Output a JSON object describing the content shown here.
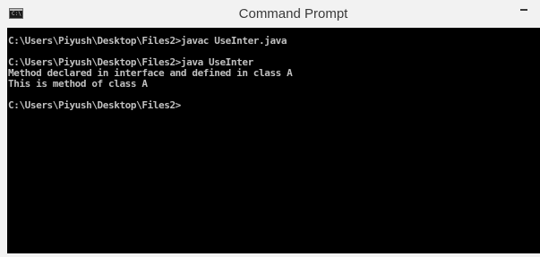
{
  "window": {
    "title": "Command Prompt",
    "app_icon": "console-icon",
    "app_icon_glyph": "C:\\",
    "controls": {
      "minimize_icon": "minimize-icon"
    }
  },
  "console": {
    "background": "#000000",
    "text_color": "#c0c0c0",
    "lines": [
      "C:\\Users\\Piyush\\Desktop\\Files2>javac UseInter.java",
      "",
      "C:\\Users\\Piyush\\Desktop\\Files2>java UseInter",
      "Method declared in interface and defined in class A",
      "This is method of class A",
      "",
      "C:\\Users\\Piyush\\Desktop\\Files2>"
    ]
  }
}
